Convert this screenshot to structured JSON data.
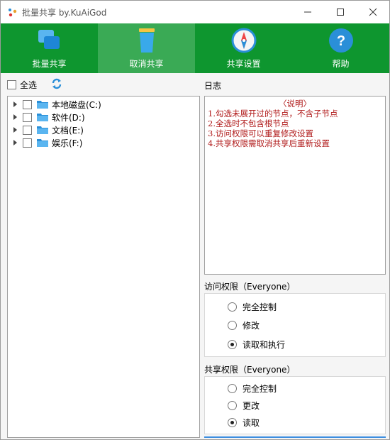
{
  "window": {
    "title": "批量共享 by.KuAiGod",
    "minimize_icon": "minimize-icon",
    "maximize_icon": "maximize-icon",
    "close_icon": "close-icon"
  },
  "toolbar": {
    "items": [
      {
        "label": "批量共享",
        "icon": "batch-share-icon",
        "active": false
      },
      {
        "label": "取消共享",
        "icon": "trash-icon",
        "active": true
      },
      {
        "label": "共享设置",
        "icon": "compass-icon",
        "active": false
      },
      {
        "label": "帮助",
        "icon": "help-icon",
        "active": false
      }
    ]
  },
  "select_all": {
    "label": "全选",
    "checked": false
  },
  "tree": {
    "nodes": [
      {
        "label": "本地磁盘(C:)",
        "checked": false
      },
      {
        "label": "软件(D:)",
        "checked": false
      },
      {
        "label": "文档(E:)",
        "checked": false
      },
      {
        "label": "娱乐(F:)",
        "checked": false
      }
    ]
  },
  "log": {
    "label": "日志",
    "heading": "〈说明〉",
    "lines": [
      "1.勾选未展开过的节点，不含子节点",
      "2.全选时不包含根节点",
      "3.访问权限可以重复修改设置",
      "4.共享权限需取消共享后重新设置"
    ]
  },
  "access": {
    "label": "访问权限（Everyone）",
    "options": [
      {
        "label": "完全控制",
        "selected": false
      },
      {
        "label": "修改",
        "selected": false
      },
      {
        "label": "读取和执行",
        "selected": true
      }
    ]
  },
  "share": {
    "label": "共享权限（Everyone）",
    "options": [
      {
        "label": "完全控制",
        "selected": false
      },
      {
        "label": "更改",
        "selected": false
      },
      {
        "label": "读取",
        "selected": true
      }
    ]
  },
  "colors": {
    "toolbar": "#0e962f",
    "toolbar_active": "#3aaa55",
    "log_text": "#b01a1a"
  }
}
